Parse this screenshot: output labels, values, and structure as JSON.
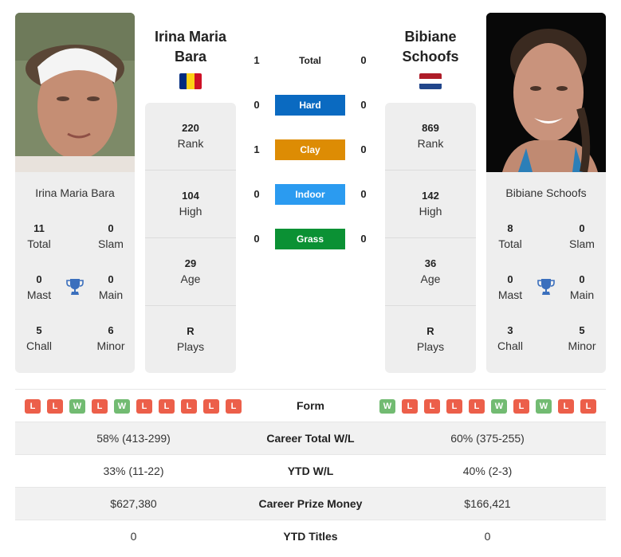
{
  "colors": {
    "hard": "#0a6ac1",
    "clay": "#dd8c04",
    "indoor": "#2b9bf0",
    "grass": "#0b9134",
    "win": "#72bb72",
    "loss": "#ec5f4a",
    "trophy": "#3a6fbd"
  },
  "player_left": {
    "name": "Irina Maria Bara",
    "photo_icon": "player-photo",
    "flag": "romania-flag",
    "flag_colors": [
      "#002b7f",
      "#fcd116",
      "#ce1126"
    ],
    "titles": {
      "total": {
        "value": "11",
        "label": "Total"
      },
      "slam": {
        "value": "0",
        "label": "Slam"
      },
      "mast": {
        "value": "0",
        "label": "Mast"
      },
      "main": {
        "value": "0",
        "label": "Main"
      },
      "chall": {
        "value": "5",
        "label": "Chall"
      },
      "minor": {
        "value": "6",
        "label": "Minor"
      }
    },
    "stats": [
      {
        "value": "220",
        "label": "Rank"
      },
      {
        "value": "104",
        "label": "High"
      },
      {
        "value": "29",
        "label": "Age"
      },
      {
        "value": "R",
        "label": "Plays"
      }
    ],
    "form": [
      "L",
      "L",
      "W",
      "L",
      "W",
      "L",
      "L",
      "L",
      "L",
      "L"
    ]
  },
  "player_right": {
    "name": "Bibiane Schoofs",
    "photo_icon": "player-photo",
    "flag": "netherlands-flag",
    "flag_colors": [
      "#ae1c28",
      "#ffffff",
      "#21468b"
    ],
    "titles": {
      "total": {
        "value": "8",
        "label": "Total"
      },
      "slam": {
        "value": "0",
        "label": "Slam"
      },
      "mast": {
        "value": "0",
        "label": "Mast"
      },
      "main": {
        "value": "0",
        "label": "Main"
      },
      "chall": {
        "value": "3",
        "label": "Chall"
      },
      "minor": {
        "value": "5",
        "label": "Minor"
      }
    },
    "stats": [
      {
        "value": "869",
        "label": "Rank"
      },
      {
        "value": "142",
        "label": "High"
      },
      {
        "value": "36",
        "label": "Age"
      },
      {
        "value": "R",
        "label": "Plays"
      }
    ],
    "form": [
      "W",
      "L",
      "L",
      "L",
      "L",
      "W",
      "L",
      "W",
      "L",
      "L"
    ]
  },
  "head_to_head": [
    {
      "label": "Total",
      "left": "1",
      "right": "0",
      "color": null
    },
    {
      "label": "Hard",
      "left": "0",
      "right": "0",
      "color": "#0a6ac1"
    },
    {
      "label": "Clay",
      "left": "1",
      "right": "0",
      "color": "#dd8c04"
    },
    {
      "label": "Indoor",
      "left": "0",
      "right": "0",
      "color": "#2b9bf0"
    },
    {
      "label": "Grass",
      "left": "0",
      "right": "0",
      "color": "#0b9134"
    }
  ],
  "comparison": {
    "form_label": "Form",
    "rows": [
      {
        "label": "Career Total W/L",
        "left": "58% (413-299)",
        "right": "60% (375-255)"
      },
      {
        "label": "YTD W/L",
        "left": "33% (11-22)",
        "right": "40% (2-3)"
      },
      {
        "label": "Career Prize Money",
        "left": "$627,380",
        "right": "$166,421"
      },
      {
        "label": "YTD Titles",
        "left": "0",
        "right": "0"
      }
    ]
  }
}
